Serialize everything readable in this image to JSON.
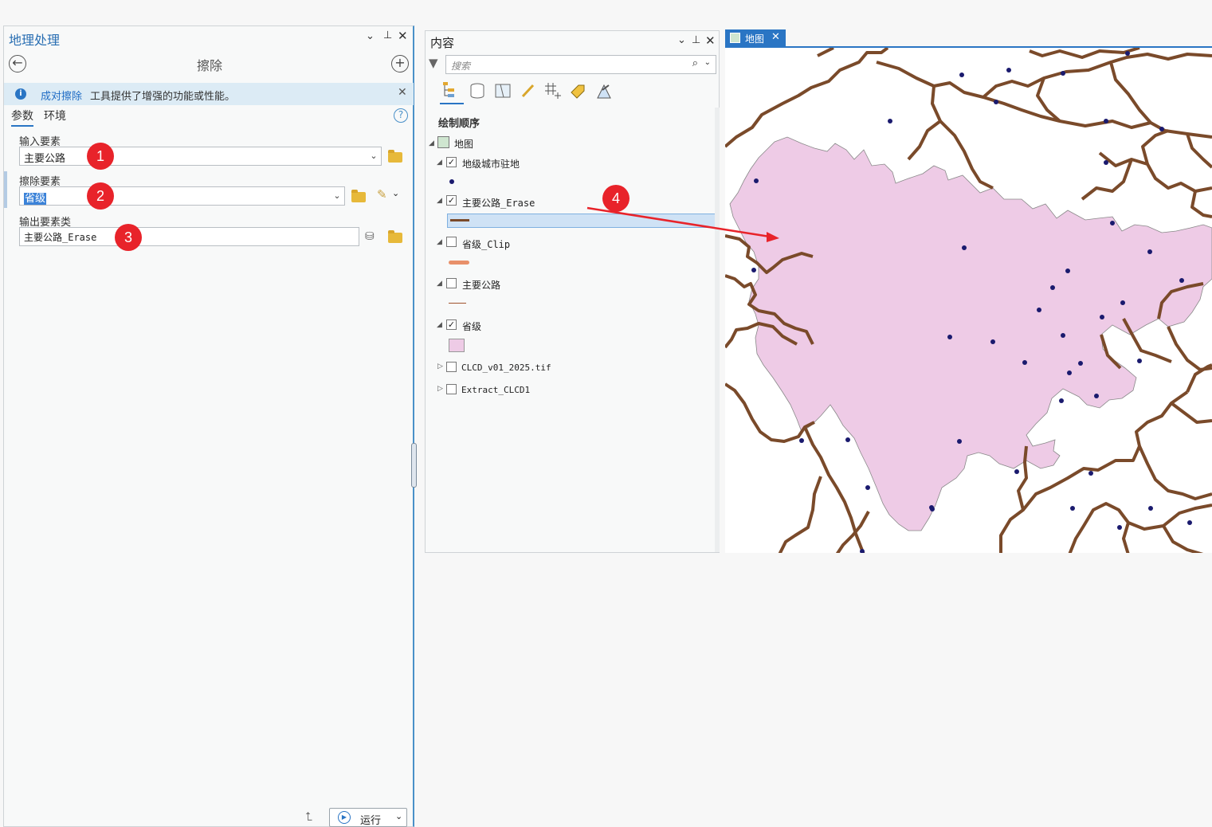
{
  "geoprocessing": {
    "title": "地理处理",
    "tool_name": "擦除",
    "info_link": "成对擦除",
    "info_message": "工具提供了增强的功能或性能。",
    "tabs": [
      "参数",
      "环境"
    ],
    "params": [
      {
        "label": "输入要素",
        "value": "主要公路",
        "badge": "1"
      },
      {
        "label": "擦除要素",
        "value": "省级",
        "badge": "2"
      },
      {
        "label": "输出要素类",
        "value": "主要公路_Erase",
        "badge": "3"
      }
    ],
    "run_label": "运行"
  },
  "contents": {
    "title": "内容",
    "search_placeholder": "搜索",
    "section": "绘制顺序",
    "map_node": "地图",
    "layers": [
      {
        "name": "地级城市驻地",
        "checked": true
      },
      {
        "name": "主要公路_Erase",
        "checked": true
      },
      {
        "name": "省级_Clip",
        "checked": false
      },
      {
        "name": "主要公路",
        "checked": false
      },
      {
        "name": "省级",
        "checked": true
      },
      {
        "name": "CLCD_v01_2025.tif",
        "checked": false
      },
      {
        "name": "Extract_CLCD1",
        "checked": false
      }
    ]
  },
  "map": {
    "tab_label": "地图",
    "annotation_badge": "4",
    "colors": {
      "province_fill": "#eecbe6",
      "road": "#7a4a2a",
      "city_point": "#1a1a6e",
      "annotation": "#e8232a"
    }
  }
}
